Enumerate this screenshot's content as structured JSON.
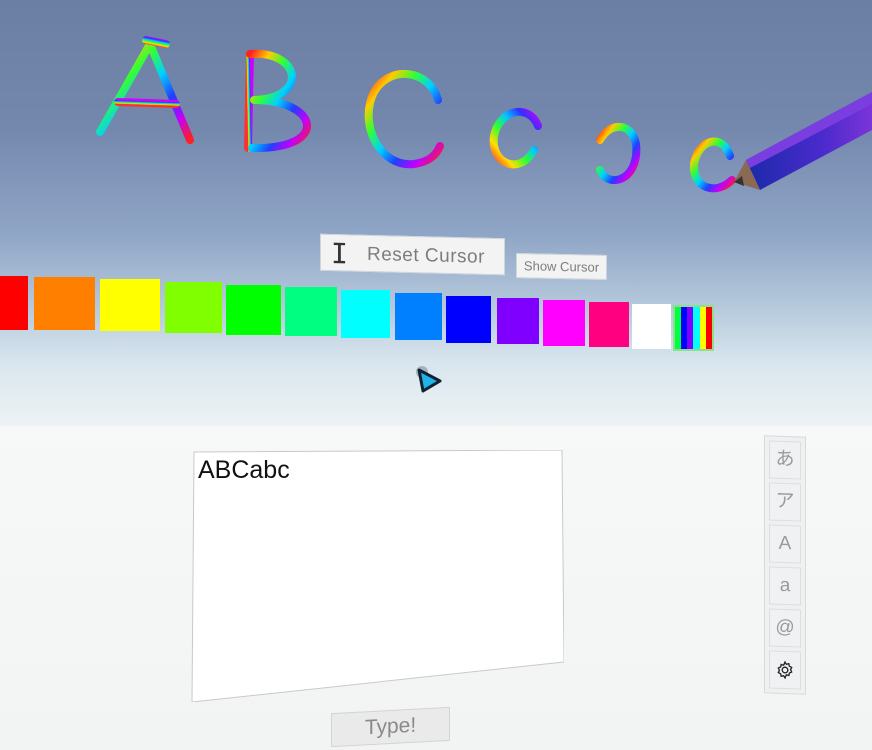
{
  "drawn_text": [
    "A",
    "B",
    "C",
    "a",
    "b",
    "c"
  ],
  "toolbar": {
    "reset_cursor_label": "Reset Cursor",
    "reset_cursor_glyph": "I",
    "show_cursor_label": "Show Cursor"
  },
  "palette": {
    "colors": [
      "#ff0000",
      "#ff8000",
      "#ffff00",
      "#80ff00",
      "#00ff00",
      "#00ff80",
      "#00ffff",
      "#0080ff",
      "#0000ff",
      "#8000ff",
      "#ff00ff",
      "#ff0080",
      "#ffffff"
    ],
    "rainbow_colors": [
      "#00ff40",
      "#0000ff",
      "#8000ff",
      "#00ffff",
      "#ffff00",
      "#ff0000"
    ],
    "selected": "rainbow"
  },
  "editor": {
    "text": "ABCabc"
  },
  "type_button": {
    "label": "Type!"
  },
  "input_modes": [
    {
      "name": "hiragana",
      "label": "あ"
    },
    {
      "name": "katakana",
      "label": "ア"
    },
    {
      "name": "uppercase",
      "label": "A"
    },
    {
      "name": "lowercase",
      "label": "a"
    },
    {
      "name": "symbols",
      "label": "@"
    },
    {
      "name": "settings",
      "icon": "gear-icon"
    }
  ]
}
